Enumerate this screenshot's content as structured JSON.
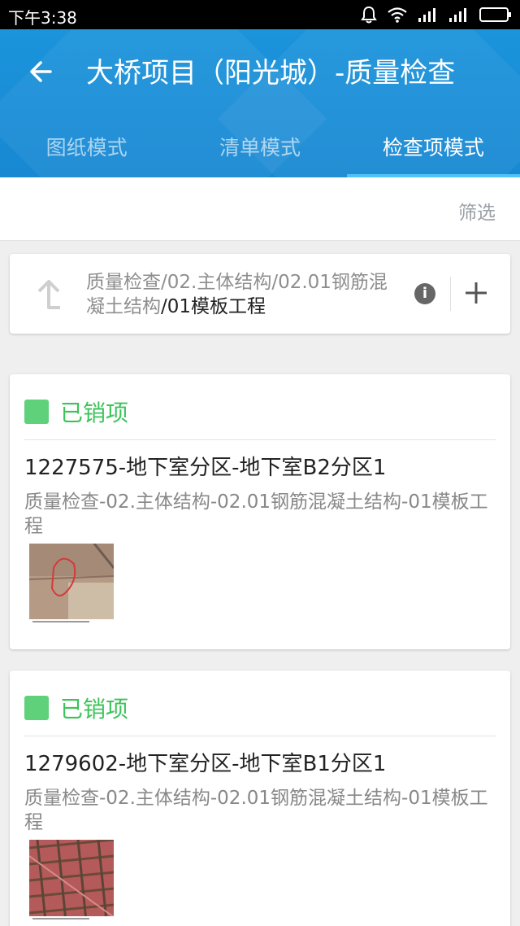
{
  "status_bar": {
    "time": "下午3:38",
    "icons": [
      "bell-icon",
      "wifi-icon",
      "signal-icon",
      "signal-icon",
      "battery-icon"
    ]
  },
  "header": {
    "title": "大桥项目（阳光城）-质量检查",
    "tabs": [
      {
        "label": "图纸模式",
        "active": false
      },
      {
        "label": "清单模式",
        "active": false
      },
      {
        "label": "检查项模式",
        "active": true
      }
    ]
  },
  "filter": {
    "label": "筛选"
  },
  "path": {
    "prefix": "质量检查/02.主体结构/02.01钢筋混凝土结构",
    "current": "/01模板工程"
  },
  "records": [
    {
      "status": "已销项",
      "code": "1227575-地下室分区-地下室B2分区1",
      "desc": "质量检查-02.主体结构-02.01钢筋混凝土结构-01模板工程"
    },
    {
      "status": "已销项",
      "code": "1279602-地下室分区-地下室B1分区1",
      "desc": "质量检查-02.主体结构-02.01钢筋混凝土结构-01模板工程"
    }
  ],
  "colors": {
    "header": "#1b94dc",
    "tab_indicator": "#4fc3f7",
    "status_green": "#3cc35b"
  }
}
